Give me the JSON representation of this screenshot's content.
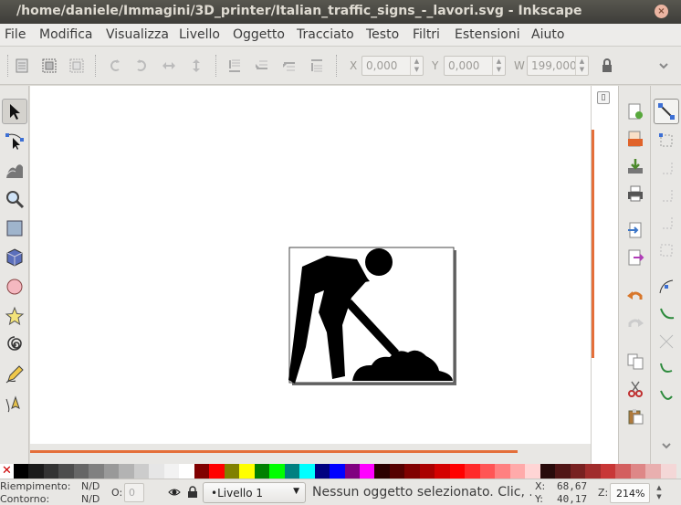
{
  "window": {
    "title": "/home/daniele/Immagini/3D_printer/Italian_traffic_signs_-_lavori.svg - Inkscape",
    "close_glyph": "×"
  },
  "menu": [
    "File",
    "Modifica",
    "Visualizza",
    "Livello",
    "Oggetto",
    "Tracciato",
    "Testo",
    "Filtri",
    "Estensioni",
    "Aiuto"
  ],
  "toolbar": {
    "x_label": "X",
    "x_value": "0,000",
    "y_label": "Y",
    "y_value": "0,000",
    "w_label": "W",
    "w_value": "199,000"
  },
  "tools": [
    {
      "name": "selector-icon",
      "active": true
    },
    {
      "name": "node-editor-icon"
    },
    {
      "name": "tweak-icon"
    },
    {
      "name": "zoom-icon"
    },
    {
      "name": "rectangle-icon"
    },
    {
      "name": "box3d-icon"
    },
    {
      "name": "ellipse-icon"
    },
    {
      "name": "star-icon"
    },
    {
      "name": "spiral-icon"
    },
    {
      "name": "pencil-icon"
    },
    {
      "name": "pen-icon"
    }
  ],
  "commands": [
    "new-document-icon",
    "open-file-icon",
    "save-icon",
    "print-icon",
    "import-icon",
    "export-icon",
    "undo-icon",
    "redo-icon",
    "copy-icon",
    "cut-icon",
    "paste-icon"
  ],
  "snaps": [
    "snap-toggle-icon",
    "snap-bbox-icon",
    "snap-bbox-edge-icon",
    "snap-bbox-corner-icon",
    "snap-bbox-midpoint-icon",
    "snap-bbox-center-icon",
    "snap-nodes-icon",
    "snap-path-icon",
    "snap-intersection-icon",
    "snap-smooth-icon",
    "snap-midpoint-icon"
  ],
  "palette": {
    "none_glyph": "✕",
    "colors": [
      "#000000",
      "#1a1a1a",
      "#333333",
      "#4d4d4d",
      "#666666",
      "#808080",
      "#999999",
      "#b3b3b3",
      "#cccccc",
      "#e6e6e6",
      "#f2f2f2",
      "#ffffff",
      "#800000",
      "#ff0000",
      "#808000",
      "#ffff00",
      "#008000",
      "#00ff00",
      "#008080",
      "#00ffff",
      "#000080",
      "#0000ff",
      "#800080",
      "#ff00ff",
      "#2b0000",
      "#550000",
      "#800000",
      "#aa0000",
      "#d40000",
      "#ff0000",
      "#ff2a2a",
      "#ff5555",
      "#ff8080",
      "#ffaaaa",
      "#ffd5d5",
      "#280b0b",
      "#501616",
      "#782121",
      "#a02c2c",
      "#c83737",
      "#d35f5f",
      "#de8787",
      "#e9afaf",
      "#f4d7d7"
    ]
  },
  "status": {
    "fill_label": "Riempimento:",
    "fill_value": "N/D",
    "stroke_label": "Contorno:",
    "stroke_value": "N/D",
    "opacity_label": "O:",
    "opacity_value": "0",
    "layer": "•Livello 1",
    "message": "Nessun oggetto selezionato. Clic, ...",
    "x_label": "X:",
    "x_value": "68,67",
    "y_label": "Y:",
    "y_value": "40,17",
    "zoom_label": "Z:",
    "zoom_value": "214%"
  }
}
